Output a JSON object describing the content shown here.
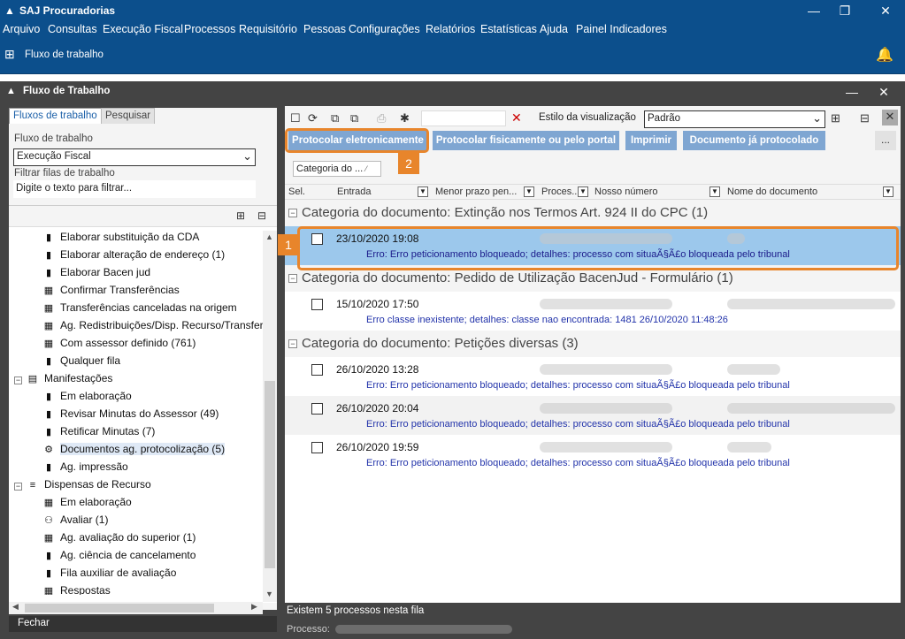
{
  "app": {
    "title": "SAJ Procuradorias"
  },
  "menu": [
    "Arquivo",
    "Consultas",
    "Execução Fiscal",
    "Processos",
    "Requisitório",
    "Pessoas",
    "Configurações",
    "Relatórios",
    "Estatísticas",
    "Ajuda",
    "Painel Indicadores"
  ],
  "toolbar": {
    "workflow_label": "Fluxo de trabalho"
  },
  "window": {
    "title": "Fluxo de Trabalho"
  },
  "left": {
    "tabs": [
      "Fluxos de trabalho",
      "Pesquisar"
    ],
    "fluxo_label": "Fluxo de trabalho",
    "fluxo_value": "Execução Fiscal",
    "filtrar_label": "Filtrar filas de trabalho",
    "filtrar_placeholder": "Digite o texto para filtrar...",
    "tree": [
      {
        "label": "Elaborar substituição da CDA",
        "icon": "flag-icon"
      },
      {
        "label": "Elaborar alteração de endereço (1)",
        "icon": "flag-icon"
      },
      {
        "label": "Elaborar Bacen jud",
        "icon": "flag-icon"
      },
      {
        "label": "Confirmar Transferências",
        "icon": "grid-icon"
      },
      {
        "label": "Transferências canceladas na origem",
        "icon": "grid-icon"
      },
      {
        "label": "Ag. Redistribuições/Disp. Recurso/Transfer",
        "icon": "grid-icon"
      },
      {
        "label": "Com assessor definido (761)",
        "icon": "grid-icon"
      },
      {
        "label": "Qualquer fila",
        "icon": "flag-icon"
      },
      {
        "label": "Manifestações",
        "icon": "doc-icon"
      },
      {
        "label": "Em elaboração",
        "icon": "flag-icon"
      },
      {
        "label": "Revisar Minutas do Assessor (49)",
        "icon": "flag-icon"
      },
      {
        "label": "Retificar Minutas (7)",
        "icon": "flag-icon"
      },
      {
        "label": "Documentos ag. protocolização (5)",
        "icon": "stamp-icon"
      },
      {
        "label": "Ag. impressão",
        "icon": "flag-icon"
      },
      {
        "label": "Dispensas de Recurso",
        "icon": "stack-icon"
      },
      {
        "label": "Em elaboração",
        "icon": "grid-icon"
      },
      {
        "label": "Avaliar (1)",
        "icon": "person-icon"
      },
      {
        "label": "Ag. avaliação do superior (1)",
        "icon": "grid-icon"
      },
      {
        "label": "Ag. ciência de cancelamento",
        "icon": "flag-icon"
      },
      {
        "label": "Fila auxiliar de avaliação",
        "icon": "flag-icon"
      },
      {
        "label": "Respostas",
        "icon": "grid-icon"
      }
    ],
    "fechar": "Fechar"
  },
  "right": {
    "estilo_label": "Estilo da visualização",
    "estilo_value": "Padrão",
    "buttons": [
      "Protocolar eletronicamente",
      "Protocolar fisicamente ou pelo portal",
      "Imprimir",
      "Documento já protocolado"
    ],
    "more": "...",
    "group_chip": "Categoria do ...",
    "columns": [
      "Sel.",
      "Entrada",
      "Menor prazo pen...",
      "Proces...",
      "Nosso número",
      "Nome do documento"
    ],
    "groups": [
      {
        "title": "Categoria do documento: Extinção nos Termos Art. 924 II do CPC  (1)"
      },
      {
        "title": "Categoria do documento: Pedido de Utilização BacenJud - Formulário  (1)"
      },
      {
        "title": "Categoria do documento: Petições diversas  (3)"
      }
    ],
    "rows": [
      {
        "date": "23/10/2020 19:08",
        "error": "Erro: Erro peticionamento bloqueado; detalhes: processo com situaÃ§Ã£o bloqueada pelo tribunal"
      },
      {
        "date": "15/10/2020 17:50",
        "error": "Erro classe inexistente; detalhes: classe nao encontrada: 1481 26/10/2020 11:48:26"
      },
      {
        "date": "26/10/2020 13:28",
        "error": "Erro: Erro peticionamento bloqueado; detalhes: processo com situaÃ§Ã£o bloqueada pelo tribunal"
      },
      {
        "date": "26/10/2020 20:04",
        "error": "Erro: Erro peticionamento bloqueado; detalhes: processo com situaÃ§Ã£o bloqueada pelo tribunal"
      },
      {
        "date": "26/10/2020 19:59",
        "error": "Erro: Erro peticionamento bloqueado; detalhes: processo com situaÃ§Ã£o bloqueada pelo tribunal"
      }
    ],
    "badges": [
      "1",
      "2"
    ],
    "status": "Existem 5 processos nesta fila",
    "processo_label": "Processo:"
  }
}
